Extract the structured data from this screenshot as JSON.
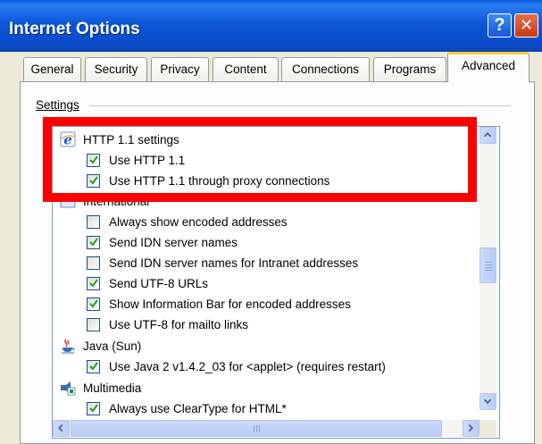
{
  "window": {
    "title": "Internet Options",
    "help_glyph": "?",
    "close_glyph": "✕"
  },
  "tabs": [
    {
      "label": "General"
    },
    {
      "label": "Security"
    },
    {
      "label": "Privacy"
    },
    {
      "label": "Content"
    },
    {
      "label": "Connections"
    },
    {
      "label": "Programs"
    },
    {
      "label": "Advanced",
      "active": true
    }
  ],
  "settings": {
    "label": "Settings",
    "groups": {
      "http11": {
        "label": "HTTP 1.1 settings",
        "icon": "ie-settings-icon",
        "items": [
          {
            "label": "Use HTTP 1.1",
            "checked": true
          },
          {
            "label": "Use HTTP 1.1 through proxy connections",
            "checked": true
          }
        ]
      },
      "international": {
        "label": "International*",
        "icon": "ie-settings-icon",
        "items": [
          {
            "label": "Always show encoded addresses",
            "checked": false
          },
          {
            "label": "Send IDN server names",
            "checked": true
          },
          {
            "label": "Send IDN server names for Intranet addresses",
            "checked": false
          },
          {
            "label": "Send UTF-8 URLs",
            "checked": true
          },
          {
            "label": "Show Information Bar for encoded addresses",
            "checked": true
          },
          {
            "label": "Use UTF-8 for mailto links",
            "checked": false
          }
        ]
      },
      "java": {
        "label": "Java (Sun)",
        "icon": "java-cup-icon",
        "items": [
          {
            "label": "Use Java 2 v1.4.2_03 for <applet> (requires restart)",
            "checked": true
          }
        ]
      },
      "multimedia": {
        "label": "Multimedia",
        "icon": "multimedia-icon",
        "items": [
          {
            "label": "Always use ClearType for HTML*",
            "checked": true
          }
        ]
      }
    }
  },
  "colors": {
    "titlebar": "#0a4ccc",
    "highlight": "#ff0000",
    "active_tab_accent": "#ffc83c",
    "checkmark": "#21a121"
  }
}
